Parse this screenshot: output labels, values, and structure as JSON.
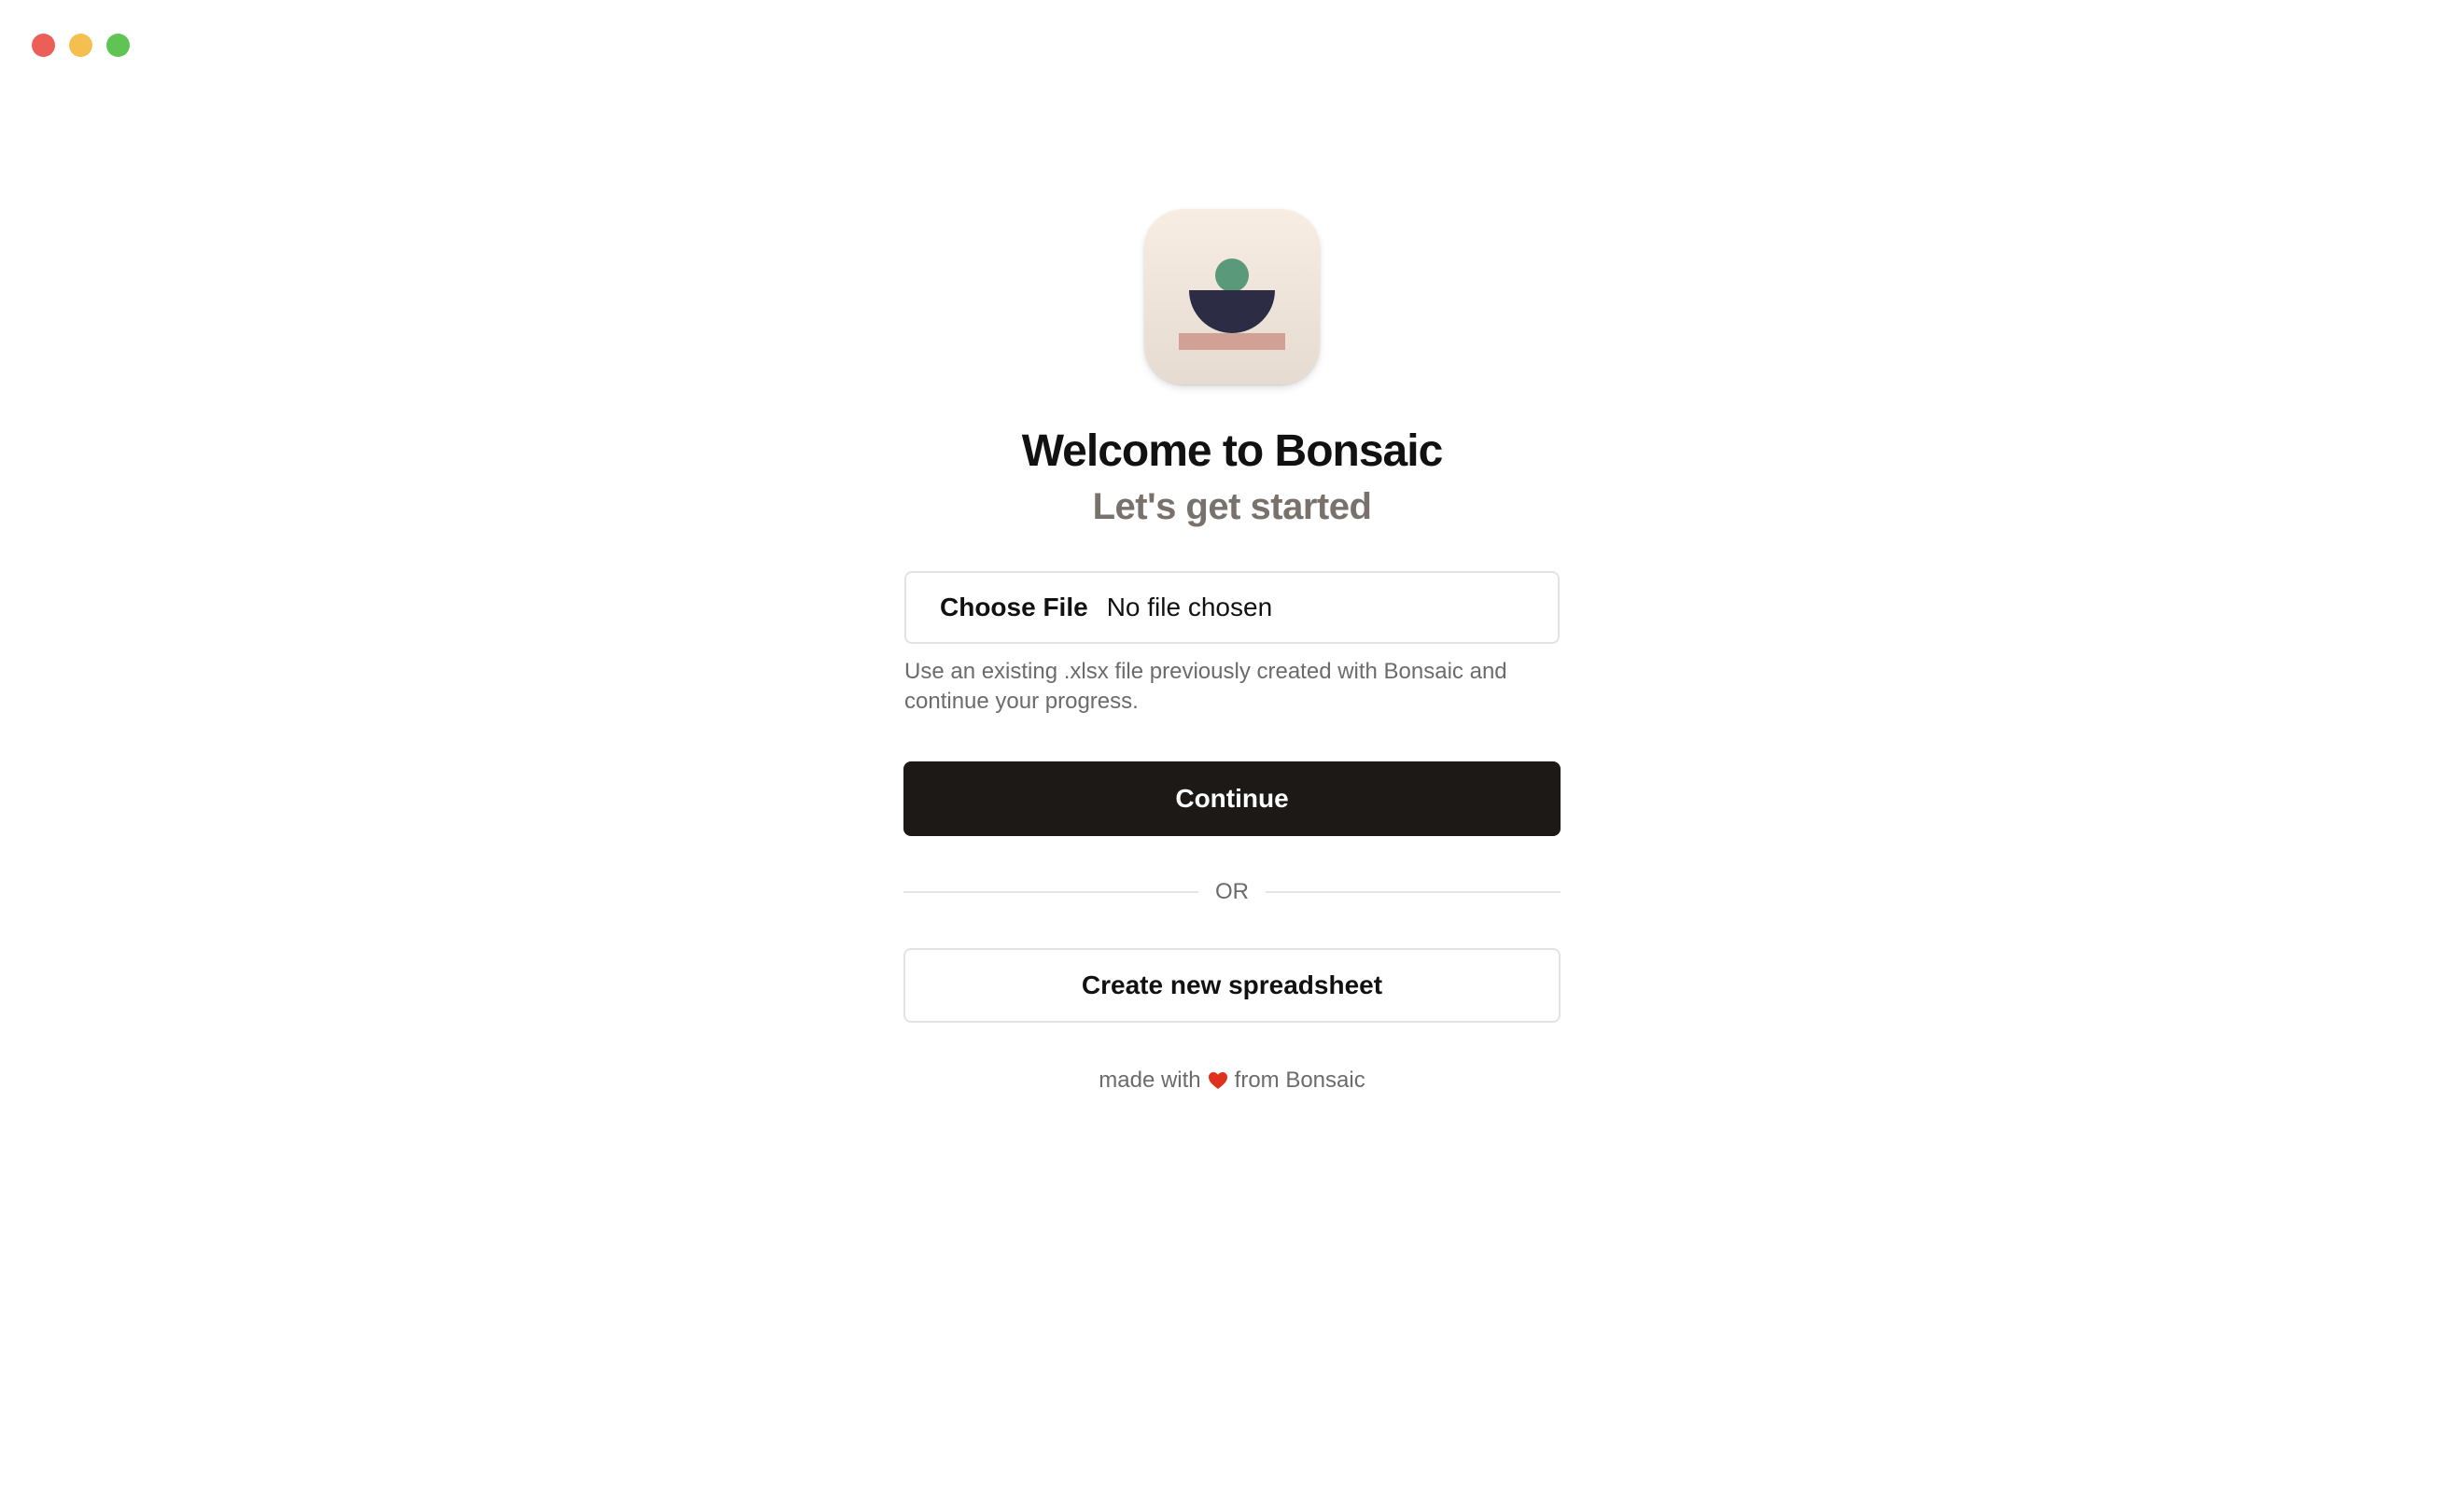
{
  "window": {
    "traffic_lights": {
      "close_color": "#ec5f59",
      "minimize_color": "#f4bf4f",
      "maximize_color": "#5fc454"
    }
  },
  "app_icon": {
    "icon": "bonsaic-logo-icon",
    "colors": {
      "circle": "#5a9a7a",
      "bowl": "#2c2d44",
      "base": "#d1a196"
    }
  },
  "welcome": {
    "title": "Welcome to Bonsaic",
    "subtitle": "Let's get started"
  },
  "file_picker": {
    "button_label": "Choose File",
    "status": "No file chosen",
    "hint": "Use an existing .xlsx file previously created with Bonsaic and continue your progress."
  },
  "actions": {
    "continue_label": "Continue",
    "or_label": "OR",
    "create_label": "Create new spreadsheet"
  },
  "footer": {
    "prefix": "made with",
    "icon": "heart-icon",
    "suffix": "from Bonsaic",
    "heart_color": "#e0301e"
  }
}
